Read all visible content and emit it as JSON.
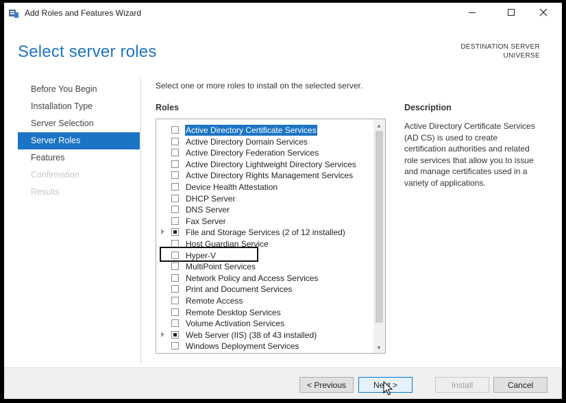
{
  "window": {
    "title": "Add Roles and Features Wizard",
    "controls": {
      "minimize": "minimize",
      "maximize": "maximize",
      "close": "close"
    }
  },
  "header": {
    "page_title": "Select server roles",
    "destination_label": "DESTINATION SERVER",
    "destination_server": "UNIVERSE"
  },
  "nav": {
    "items": [
      {
        "label": "Before You Begin",
        "state": "normal"
      },
      {
        "label": "Installation Type",
        "state": "normal"
      },
      {
        "label": "Server Selection",
        "state": "normal"
      },
      {
        "label": "Server Roles",
        "state": "active"
      },
      {
        "label": "Features",
        "state": "normal"
      },
      {
        "label": "Confirmation",
        "state": "disabled"
      },
      {
        "label": "Results",
        "state": "disabled"
      }
    ]
  },
  "main": {
    "instruction": "Select one or more roles to install on the selected server.",
    "roles_heading": "Roles",
    "roles": [
      {
        "label": "Active Directory Certificate Services",
        "checked": false,
        "selected": true
      },
      {
        "label": "Active Directory Domain Services",
        "checked": false
      },
      {
        "label": "Active Directory Federation Services",
        "checked": false
      },
      {
        "label": "Active Directory Lightweight Directory Services",
        "checked": false
      },
      {
        "label": "Active Directory Rights Management Services",
        "checked": false
      },
      {
        "label": "Device Health Attestation",
        "checked": false
      },
      {
        "label": "DHCP Server",
        "checked": false
      },
      {
        "label": "DNS Server",
        "checked": false
      },
      {
        "label": "Fax Server",
        "checked": false
      },
      {
        "label": "File and Storage Services (2 of 12 installed)",
        "checked": "partial",
        "expandable": true
      },
      {
        "label": "Host Guardian Service",
        "checked": false
      },
      {
        "label": "Hyper-V",
        "checked": false
      },
      {
        "label": "MultiPoint Services",
        "checked": false
      },
      {
        "label": "Network Policy and Access Services",
        "checked": false
      },
      {
        "label": "Print and Document Services",
        "checked": false
      },
      {
        "label": "Remote Access",
        "checked": false
      },
      {
        "label": "Remote Desktop Services",
        "checked": false
      },
      {
        "label": "Volume Activation Services",
        "checked": false
      },
      {
        "label": "Web Server (IIS) (38 of 43 installed)",
        "checked": "partial",
        "expandable": true
      },
      {
        "label": "Windows Deployment Services",
        "checked": false
      }
    ],
    "description_heading": "Description",
    "description": "Active Directory Certificate Services (AD CS) is used to create certification authorities and related role services that allow you to issue and manage certificates used in a variety of applications."
  },
  "footer": {
    "previous": "< Previous",
    "next": "Next >",
    "install": "Install",
    "cancel": "Cancel"
  },
  "colors": {
    "accent": "#1c74c4",
    "title": "#1c74c4"
  }
}
